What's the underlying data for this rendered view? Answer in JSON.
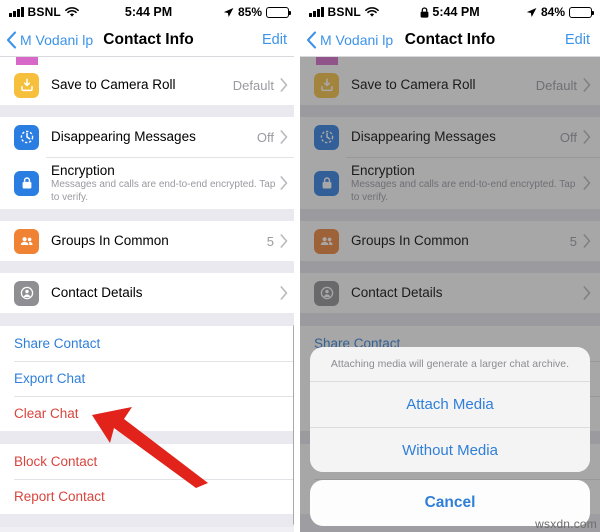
{
  "left": {
    "status": {
      "carrier": "BSNL",
      "time": "5:44 PM",
      "battery_pct": "85%",
      "has_lock": false
    },
    "nav": {
      "back_label": "M Vodani lp",
      "title": "Contact Info",
      "edit_label": "Edit"
    },
    "rows": [
      {
        "title": "Save to Camera Roll",
        "sub": "",
        "value": "Default",
        "icon": "download-tray-icon",
        "color": "#f6c03c"
      },
      {
        "title": "Disappearing Messages",
        "sub": "",
        "value": "Off",
        "icon": "timer-icon",
        "color": "#2a7de1"
      },
      {
        "title": "Encryption",
        "sub": "Messages and calls are end-to-end encrypted. Tap to verify.",
        "value": "",
        "icon": "lock-icon",
        "color": "#2a7de1"
      },
      {
        "title": "Groups In Common",
        "sub": "",
        "value": "5",
        "icon": "people-icon",
        "color": "#ef8233"
      },
      {
        "title": "Contact Details",
        "sub": "",
        "value": "",
        "icon": "contact-card-icon",
        "color": "#8e8e93"
      }
    ],
    "links_group_a": [
      {
        "label": "Share Contact",
        "style": "blue"
      },
      {
        "label": "Export Chat",
        "style": "blue"
      },
      {
        "label": "Clear Chat",
        "style": "red"
      }
    ],
    "links_group_b": [
      {
        "label": "Block Contact",
        "style": "red"
      },
      {
        "label": "Report Contact",
        "style": "red"
      }
    ]
  },
  "right": {
    "status": {
      "carrier": "BSNL",
      "time": "5:44 PM",
      "battery_pct": "84%",
      "has_lock": true
    },
    "nav": {
      "back_label": "M Vodani lp",
      "title": "Contact Info",
      "edit_label": "Edit"
    },
    "rows": [
      {
        "title": "Save to Camera Roll",
        "sub": "",
        "value": "Default",
        "icon": "download-tray-icon",
        "color": "#f6c03c"
      },
      {
        "title": "Disappearing Messages",
        "sub": "",
        "value": "Off",
        "icon": "timer-icon",
        "color": "#2a7de1"
      },
      {
        "title": "Encryption",
        "sub": "Messages and calls are end-to-end encrypted. Tap to verify.",
        "value": "",
        "icon": "lock-icon",
        "color": "#2a7de1"
      },
      {
        "title": "Groups In Common",
        "sub": "",
        "value": "5",
        "icon": "people-icon",
        "color": "#ef8233"
      },
      {
        "title": "Contact Details",
        "sub": "",
        "value": "",
        "icon": "contact-card-icon",
        "color": "#8e8e93"
      }
    ],
    "links_group_a": [
      {
        "label": "Share Contact",
        "style": "blue"
      }
    ],
    "action_sheet": {
      "message": "Attaching media will generate a larger chat archive.",
      "buttons": [
        "Attach Media",
        "Without Media"
      ],
      "cancel_label": "Cancel"
    }
  },
  "annotation": {
    "arrow": "red-arrow-pointing-to-export-chat"
  },
  "watermark": "wsxdn.com",
  "colors": {
    "accent_blue": "#2f7fd8",
    "destructive_red": "#d8453e",
    "nav_blue": "#3d93e8"
  }
}
